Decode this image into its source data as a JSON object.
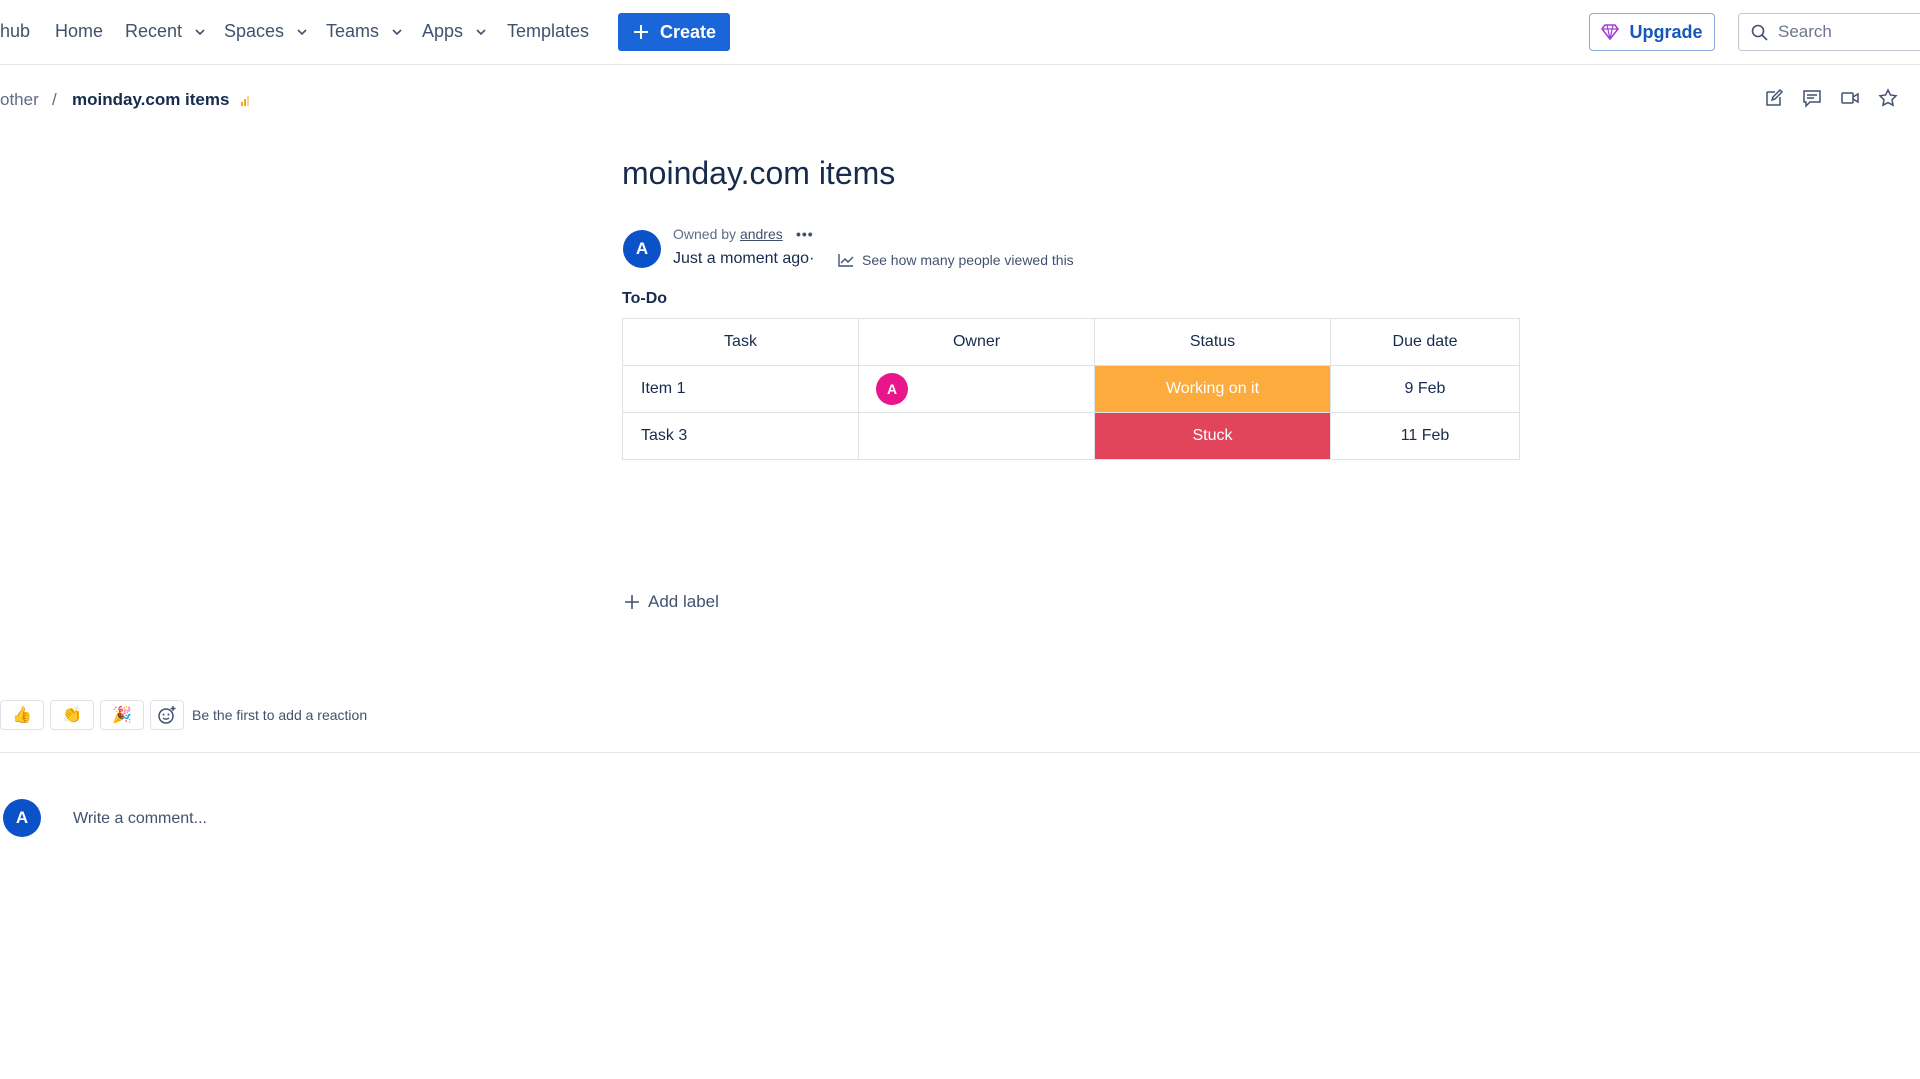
{
  "nav": {
    "brand": "hub",
    "home": "Home",
    "recent": "Recent",
    "spaces": "Spaces",
    "teams": "Teams",
    "apps": "Apps",
    "templates": "Templates",
    "create": "Create",
    "upgrade": "Upgrade",
    "search_placeholder": "Search"
  },
  "breadcrumb": {
    "parent": "other",
    "separator": "/",
    "current": "moinday.com items"
  },
  "page": {
    "title": "moinday.com items",
    "owner_avatar": "A",
    "owned_by_prefix": "Owned by",
    "owner_name": "andres",
    "more": "•••",
    "timestamp": "Just a moment ago·",
    "views_link": "See how many people viewed this",
    "section_label": "To-Do"
  },
  "table": {
    "headers": [
      "Task",
      "Owner",
      "Status",
      "Due date"
    ],
    "rows": [
      {
        "task": "Item 1",
        "owner": "A",
        "status": "Working on it",
        "status_color": "#fdab3d",
        "due": "9 Feb"
      },
      {
        "task": "Task 3",
        "owner": "",
        "status": "Stuck",
        "status_color": "#e2445c",
        "due": "11 Feb"
      }
    ]
  },
  "labels": {
    "add_label": "Add label"
  },
  "reactions": {
    "items": [
      "👍",
      "👏",
      "🎉"
    ],
    "prompt": "Be the first to add a reaction"
  },
  "comment": {
    "avatar": "A",
    "placeholder": "Write a comment..."
  },
  "colors": {
    "primary": "#1a66d9",
    "owner_pink": "#e8168a",
    "avatar_blue": "#0b52c8"
  }
}
